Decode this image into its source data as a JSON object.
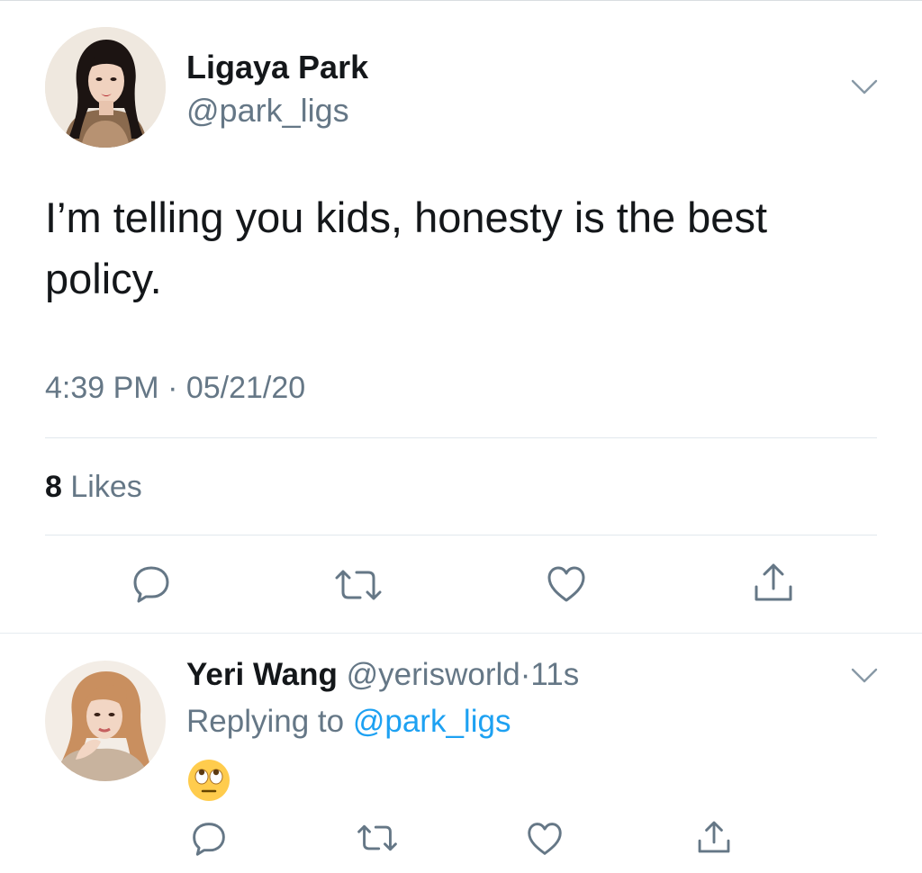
{
  "tweet": {
    "author": {
      "name": "Ligaya Park",
      "handle": "@park_ligs",
      "avatar": "profile-photo-woman-dark-hair"
    },
    "text": "I’m telling you kids, honesty is the best policy.",
    "timestamp": "4:39 PM · 05/21/20",
    "likes": {
      "count": "8",
      "label": "Likes"
    },
    "actions": [
      "reply-icon",
      "retweet-icon",
      "like-icon",
      "share-icon"
    ],
    "menu_icon": "chevron-down-icon"
  },
  "reply": {
    "author": {
      "name": "Yeri Wang",
      "handle": "@yerisworld",
      "avatar": "profile-photo-woman-auburn-hair"
    },
    "separator": "·",
    "time": "11s",
    "replying_prefix": "Replying to",
    "replying_to": "@park_ligs",
    "content_emoji": "face-with-rolling-eyes",
    "actions": [
      "reply-icon",
      "retweet-icon",
      "like-icon",
      "share-icon"
    ],
    "menu_icon": "chevron-down-icon"
  },
  "colors": {
    "text_primary": "#14171a",
    "text_secondary": "#657786",
    "link": "#1da1f2",
    "icon": "#657786",
    "divider": "#e1e8ed"
  }
}
